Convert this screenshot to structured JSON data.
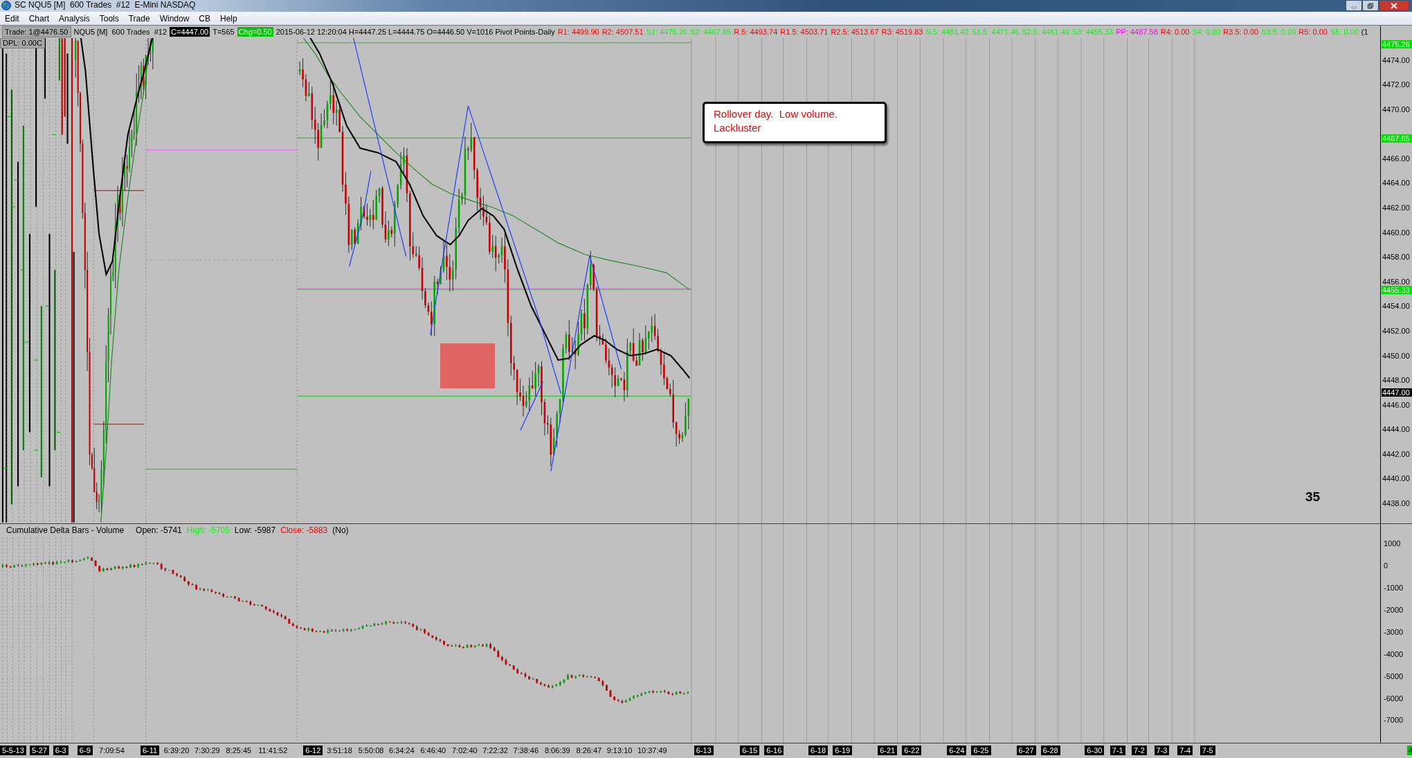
{
  "window": {
    "title": "SC NQU5 [M]  600 Trades  #12  E-Mini NASDAQ"
  },
  "menu": [
    "Edit",
    "Chart",
    "Analysis",
    "Tools",
    "Trade",
    "Window",
    "CB",
    "Help"
  ],
  "info_line": {
    "trade": "Trade: 1@4476.50",
    "symbol": "NQU5 [M]  600 Trades  #12",
    "close": "C=4447.00",
    "ticks": "T=565",
    "change": "Chg=0.50",
    "bar": "2015-06-12 12:20:04 H=4447.25 L=4444.75 O=4446.50 V=1016 Pivot Points-Daily",
    "pivots": [
      {
        "text": "R1: 4499.90",
        "color": "#ff0000"
      },
      {
        "text": "R2: 4507.51",
        "color": "#ff0000"
      },
      {
        "text": "S1: 4475.26",
        "color": "#00ff00"
      },
      {
        "text": "S2: 4467.65",
        "color": "#00ff00"
      },
      {
        "text": "R.5: 4493.74",
        "color": "#ff0000"
      },
      {
        "text": "R1.5: 4503.71",
        "color": "#ff0000"
      },
      {
        "text": "R2.5: 4513.67",
        "color": "#ff0000"
      },
      {
        "text": "R3: 4519.83",
        "color": "#ff0000"
      },
      {
        "text": "S.5: 4481.42",
        "color": "#00ff00"
      },
      {
        "text": "S1.5: 4471.46",
        "color": "#00ff00"
      },
      {
        "text": "S2.5: 4461.49",
        "color": "#00ff00"
      },
      {
        "text": "S3: 4455.33",
        "color": "#00ff00"
      },
      {
        "text": "PP: 4487.58",
        "color": "#ff00ff"
      },
      {
        "text": "R4: 0.00",
        "color": "#ff0000"
      },
      {
        "text": "S4: 0.00",
        "color": "#00ff00"
      },
      {
        "text": "R3.5: 0.00",
        "color": "#ff0000"
      },
      {
        "text": "S3.5: 0.00",
        "color": "#00ff00"
      },
      {
        "text": "R5: 0.00",
        "color": "#ff0000"
      },
      {
        "text": "S5: 0.00",
        "color": "#00ff00"
      }
    ],
    "more": "(1"
  },
  "dpl": "DPL: 0.00C",
  "price_axis": {
    "labels": [
      "4474.00",
      "4472.00",
      "4470.00",
      "4466.00",
      "4464.00",
      "4462.00",
      "4460.00",
      "4458.00",
      "4456.00",
      "4454.00",
      "4452.00",
      "4450.00",
      "4448.00",
      "4446.00",
      "4444.00",
      "4442.00",
      "4440.00",
      "4438.00"
    ],
    "markers": [
      {
        "text": "4475.26",
        "color": "#00e000"
      },
      {
        "text": "4467.65",
        "color": "#00e000"
      },
      {
        "text": "4455.33",
        "color": "#00e000"
      },
      {
        "text": "4447.00",
        "color": "#000000"
      }
    ]
  },
  "note": "Rollover day.  Low volume. Lackluster",
  "bar_count": "35",
  "delta_study": {
    "header": [
      {
        "text": "Cumulative Delta Bars - Volume",
        "color": "#000000"
      },
      {
        "text": "Open: -5741",
        "color": "#000000"
      },
      {
        "text": "High: -5705",
        "color": "#00ff00"
      },
      {
        "text": "Low: -5987",
        "color": "#000000"
      },
      {
        "text": "Close: -5883",
        "color": "#ff0000"
      },
      {
        "text": "(No)",
        "color": "#000000"
      }
    ],
    "axis_labels": [
      "1000",
      "0",
      "-1000",
      "-2000",
      "-3000",
      "-4000",
      "-5000",
      "-6000",
      "-7000"
    ]
  },
  "time_axis": [
    {
      "text": "5-5-13",
      "kind": "date"
    },
    {
      "text": "5-27",
      "kind": "date"
    },
    {
      "text": "6-3",
      "kind": "date"
    },
    {
      "text": "6-9",
      "kind": "date"
    },
    {
      "text": "7:09:54",
      "kind": "time"
    },
    {
      "text": "6-11",
      "kind": "date"
    },
    {
      "text": "6:39:20",
      "kind": "time"
    },
    {
      "text": "7:30:29",
      "kind": "time"
    },
    {
      "text": "8:25:45",
      "kind": "time"
    },
    {
      "text": "11:41:52",
      "kind": "time"
    },
    {
      "text": "6-12",
      "kind": "date"
    },
    {
      "text": "3:51:18",
      "kind": "time"
    },
    {
      "text": "5:50:08",
      "kind": "time"
    },
    {
      "text": "6:34:24",
      "kind": "time"
    },
    {
      "text": "6:46:40",
      "kind": "time"
    },
    {
      "text": "7:02:40",
      "kind": "time"
    },
    {
      "text": "7:22:32",
      "kind": "time"
    },
    {
      "text": "7:38:46",
      "kind": "time"
    },
    {
      "text": "8:06:39",
      "kind": "time"
    },
    {
      "text": "8:26:47",
      "kind": "time"
    },
    {
      "text": "9:13:10",
      "kind": "time"
    },
    {
      "text": "10:37:49",
      "kind": "time"
    },
    {
      "text": "6-13",
      "kind": "date"
    },
    {
      "text": "6-15",
      "kind": "date"
    },
    {
      "text": "6-16",
      "kind": "date"
    },
    {
      "text": "6-18",
      "kind": "date"
    },
    {
      "text": "6-19",
      "kind": "date"
    },
    {
      "text": "6-21",
      "kind": "date"
    },
    {
      "text": "6-22",
      "kind": "date"
    },
    {
      "text": "6-24",
      "kind": "date"
    },
    {
      "text": "6-25",
      "kind": "date"
    },
    {
      "text": "6-27",
      "kind": "date"
    },
    {
      "text": "6-28",
      "kind": "date"
    },
    {
      "text": "6-30",
      "kind": "date"
    },
    {
      "text": "7-1",
      "kind": "date"
    },
    {
      "text": "7-2",
      "kind": "date"
    },
    {
      "text": "7-3",
      "kind": "date"
    },
    {
      "text": "7-4",
      "kind": "date"
    },
    {
      "text": "7-5",
      "kind": "date"
    },
    {
      "text": "4",
      "kind": "price"
    }
  ]
}
